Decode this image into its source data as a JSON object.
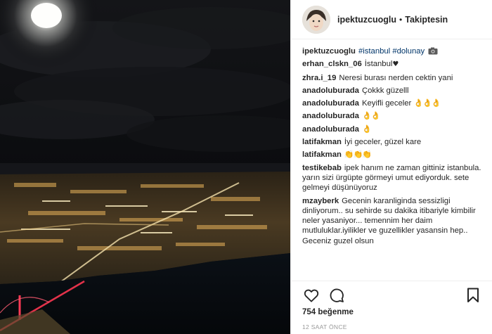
{
  "header": {
    "username": "ipektuzcuoglu",
    "separator": "•",
    "follow_status": "Takiptesin"
  },
  "caption": {
    "username": "ipektuzcuoglu",
    "hashtag_1": "#istanbul",
    "hashtag_2": "#dolunay",
    "icon": "camera-icon"
  },
  "comments": [
    {
      "username": "erhan_clskn_06",
      "text": "İstanbul",
      "suffix": "♥"
    },
    {
      "username": "zhra.i_19",
      "text": "Neresi burası nerden cektin yani"
    },
    {
      "username": "anadoluburada",
      "text": "Çokkk güzelll"
    },
    {
      "username": "anadoluburada",
      "text": "Keyifli geceler",
      "suffix": "👌👌👌"
    },
    {
      "username": "anadoluburada",
      "text": "",
      "suffix": "👌👌"
    },
    {
      "username": "anadoluburada",
      "text": "",
      "suffix": "👌"
    },
    {
      "username": "latifakman",
      "text": "İyi geceler, güzel kare"
    },
    {
      "username": "latifakman",
      "text": "",
      "suffix": "👏👏👏"
    },
    {
      "username": "testikebab",
      "text": "ipek hanım ne zaman gittiniz istanbula. yarın sizi ürgüpte görmeyi umut ediyorduk. sete gelmeyi düşünüyoruz"
    },
    {
      "username": "mzayberk",
      "text": "Gecenin karanliginda sessizligi dinliyorum.. su sehirde su dakika itibariyle kimbilir neler yasaniyor... temennim her daim mutluluklar.iyilikler ve guzellikler yasansin hep.. Geceniz guzel olsun"
    }
  ],
  "actions": {
    "like_icon": "heart-icon",
    "comment_icon": "comment-icon",
    "save_icon": "bookmark-icon"
  },
  "likes": "754 beğenme",
  "timestamp": "12 SAAT ÖNCE"
}
